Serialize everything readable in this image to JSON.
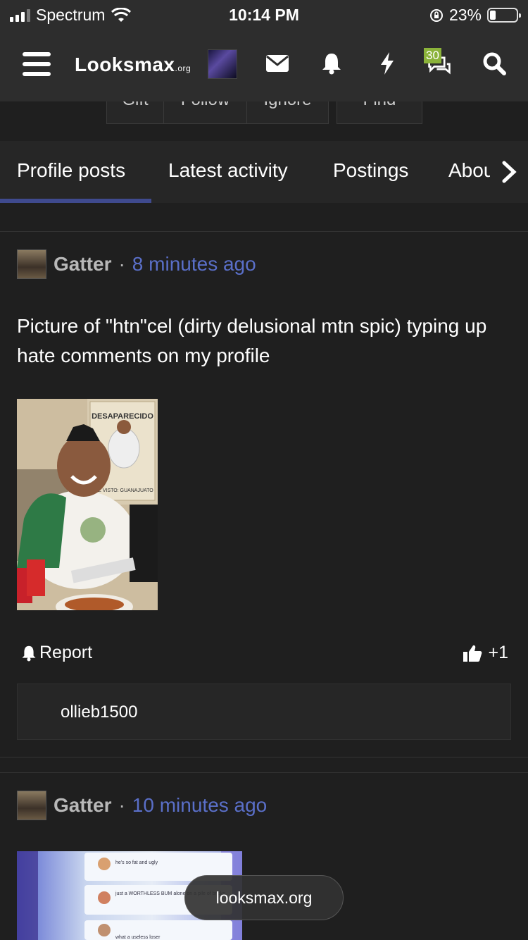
{
  "status_bar": {
    "carrier": "Spectrum",
    "time": "10:14 PM",
    "battery_percent": "23%",
    "battery_level": 0.23,
    "icons": [
      "signal-icon",
      "wifi-icon",
      "orientation-lock-icon",
      "battery-icon"
    ]
  },
  "nav": {
    "logo_text": "Looksmax",
    "logo_suffix": ".org",
    "alerts_badge": "30",
    "icons": [
      "menu-icon",
      "avatar-icon",
      "mail-icon",
      "bell-icon",
      "lightning-icon",
      "chat-icon",
      "search-icon"
    ]
  },
  "profile_actions": {
    "buttons": [
      "Gift",
      "Follow",
      "Ignore",
      "Find"
    ]
  },
  "tabs": {
    "items": [
      "Profile posts",
      "Latest activity",
      "Postings",
      "About"
    ],
    "active": "Profile posts"
  },
  "posts": [
    {
      "author": "Gatter",
      "separator": "·",
      "time": "8 minutes ago",
      "text": "Picture of \"htn\"cel (dirty delusional mtn spic) typing up hate comments on my profile",
      "image_poster_title": "DESAPARECIDO",
      "image_poster_caption": "VEZ VISTO: GUANAJUATO",
      "report_label": "Report",
      "like_count": "+1",
      "comment_author": "ollieb1500"
    },
    {
      "author": "Gatter",
      "separator": "·",
      "time": "10 minutes ago",
      "image_snippet_1": "he's so fat and ugly",
      "image_snippet_2": "just a WORTHLESS BUM alone on a pile of bricks",
      "image_snippet_3": "what a useless loser"
    }
  ],
  "toast": {
    "text": "looksmax.org"
  },
  "colors": {
    "background": "#1f1f1f",
    "bar": "#2d2d2d",
    "link": "#5a6fc8",
    "tab_underline": "#3f4a8e",
    "badge": "#8bb33a"
  }
}
